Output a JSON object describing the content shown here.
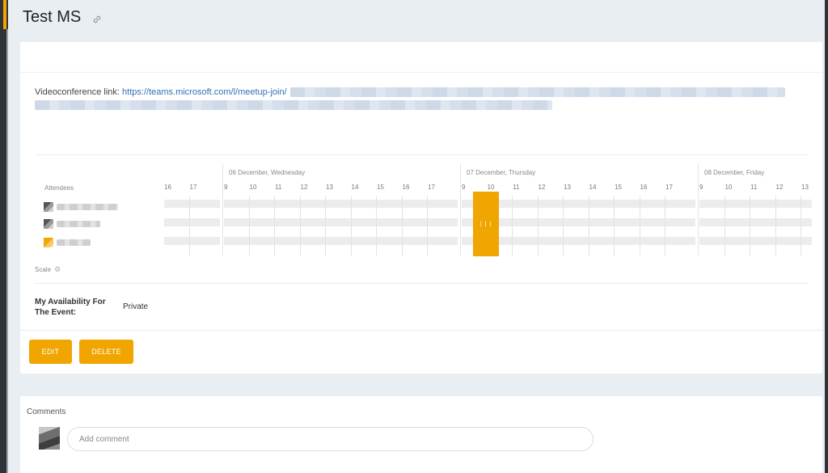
{
  "page": {
    "title": "Test MS"
  },
  "event": {
    "videoconference_label": "Videoconference link:",
    "videoconference_url": "https://teams.microsoft.com/l/meetup-join/"
  },
  "schedule": {
    "attendees_label": "Attendees",
    "days": [
      {
        "label": "06 December, Wednesday"
      },
      {
        "label": "07 December, Thursday"
      },
      {
        "label": "08 December, Friday"
      }
    ],
    "hours_prev_day": [
      "16",
      "17"
    ],
    "hours_day1": [
      "9",
      "10",
      "11",
      "12",
      "13",
      "14",
      "15",
      "16",
      "17"
    ],
    "hours_day2": [
      "9",
      "10",
      "11",
      "12",
      "13",
      "14",
      "15",
      "16",
      "17"
    ],
    "hours_day3": [
      "9",
      "10",
      "11",
      "12",
      "13"
    ],
    "event_block_label": "| | |",
    "scale_label": "Scale"
  },
  "availability": {
    "label_line1": "My Availability For",
    "label_line2": "The Event:",
    "value": "Private"
  },
  "actions": {
    "edit_label": "EDIT",
    "delete_label": "DELETE"
  },
  "comments": {
    "title": "Comments",
    "placeholder": "Add comment"
  },
  "colors": {
    "accent": "#f0a500",
    "link": "#2f6fb5",
    "background": "#e9eef3"
  },
  "icons": {
    "title_link": "link-icon",
    "scale_settings": "gear-icon"
  }
}
